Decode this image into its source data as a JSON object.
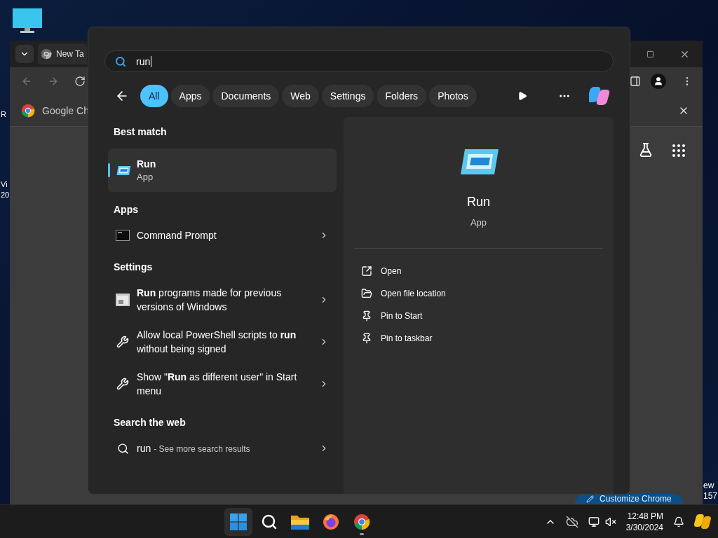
{
  "desktop": {
    "left_labels": [
      "R",
      "Vi",
      "20"
    ],
    "right_labels": [
      "ew",
      "157"
    ]
  },
  "browser": {
    "tab_title": "New Ta",
    "bookmark": "Google Ch",
    "customize_button": "Customize Chrome"
  },
  "search": {
    "value": "run"
  },
  "filters": [
    {
      "label": "All",
      "selected": true
    },
    {
      "label": "Apps",
      "selected": false
    },
    {
      "label": "Documents",
      "selected": false
    },
    {
      "label": "Web",
      "selected": false
    },
    {
      "label": "Settings",
      "selected": false
    },
    {
      "label": "Folders",
      "selected": false
    },
    {
      "label": "Photos",
      "selected": false
    }
  ],
  "best_match": {
    "heading": "Best match",
    "title": "Run",
    "subtitle": "App",
    "selected": true
  },
  "sections": [
    {
      "heading": "Apps",
      "items": [
        {
          "kind": "cmd",
          "text": "Command Prompt"
        }
      ]
    },
    {
      "heading": "Settings",
      "items": [
        {
          "kind": "compat",
          "text": "**Run** programs made for previous versions of Windows"
        },
        {
          "kind": "tools",
          "text": "Allow local PowerShell scripts to **run** without being signed"
        },
        {
          "kind": "tools",
          "text": "Show \"**Run** as different user\" in Start menu"
        }
      ]
    },
    {
      "heading": "Search the web",
      "items": [
        {
          "kind": "web",
          "text": "run",
          "hint": "- See more search results"
        }
      ]
    }
  ],
  "details": {
    "title": "Run",
    "subtitle": "App",
    "actions": [
      {
        "kind": "open",
        "label": "Open"
      },
      {
        "kind": "folder",
        "label": "Open file location"
      },
      {
        "kind": "pin",
        "label": "Pin to Start"
      },
      {
        "kind": "pin",
        "label": "Pin to taskbar"
      }
    ]
  },
  "taskbar": {
    "apps": [
      {
        "kind": "start",
        "selected": true,
        "running": false
      },
      {
        "kind": "search",
        "selected": false,
        "running": false
      },
      {
        "kind": "explorer",
        "selected": false,
        "running": false
      },
      {
        "kind": "firefox",
        "selected": false,
        "running": false
      },
      {
        "kind": "chrome",
        "selected": false,
        "running": true
      }
    ],
    "clock": {
      "time": "12:48 PM",
      "date": "3/30/2024"
    }
  }
}
